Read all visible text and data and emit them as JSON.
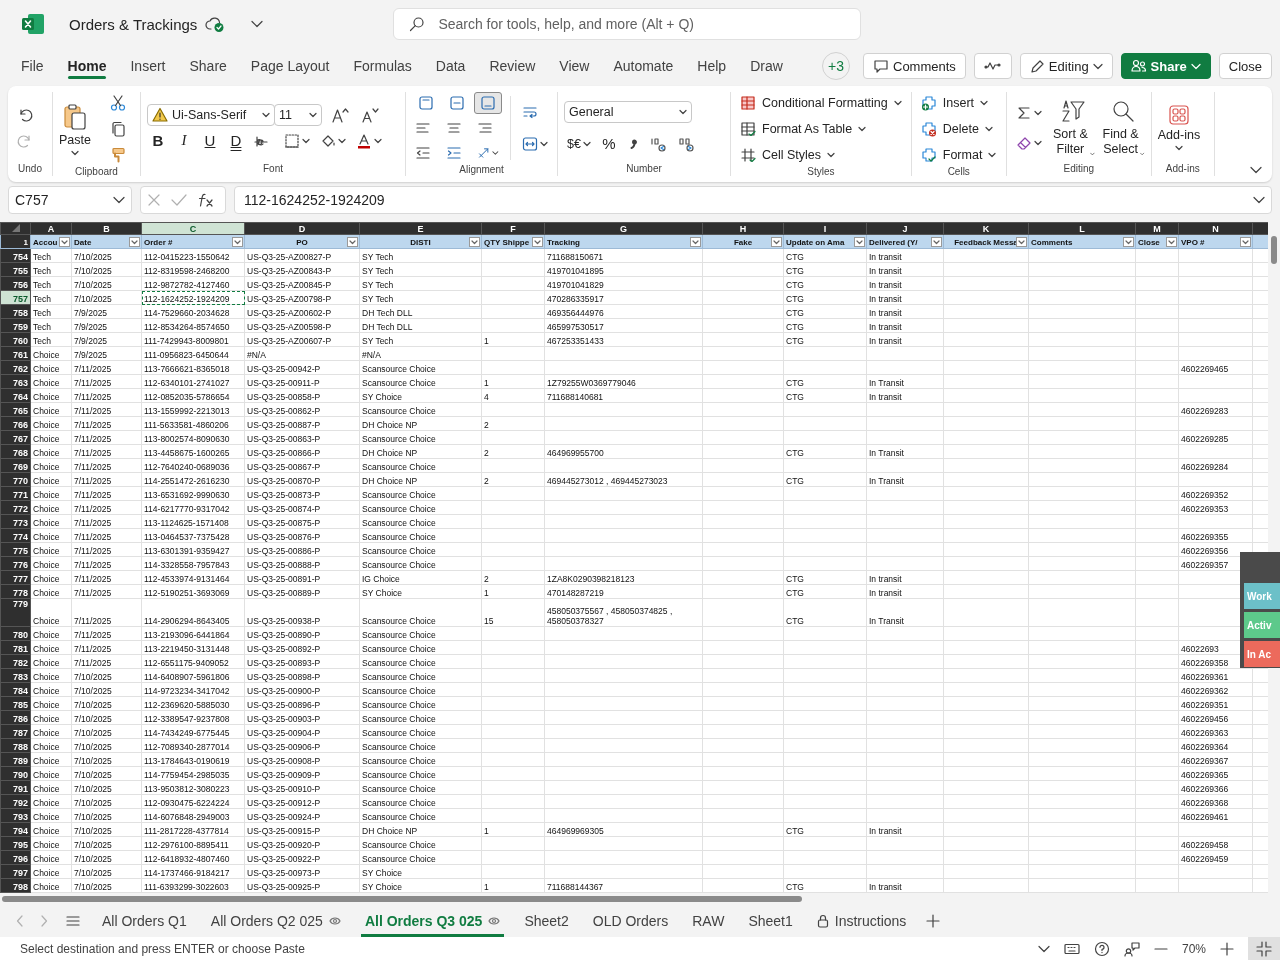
{
  "window": {
    "title": "Orders & Trackings"
  },
  "search": {
    "placeholder": "Search for tools, help, and more (Alt + Q)"
  },
  "tabs": [
    {
      "label": "File",
      "selected": false
    },
    {
      "label": "Home",
      "selected": true
    },
    {
      "label": "Insert",
      "selected": false
    },
    {
      "label": "Share",
      "selected": false
    },
    {
      "label": "Page Layout",
      "selected": false
    },
    {
      "label": "Formulas",
      "selected": false
    },
    {
      "label": "Data",
      "selected": false
    },
    {
      "label": "Review",
      "selected": false
    },
    {
      "label": "View",
      "selected": false
    },
    {
      "label": "Automate",
      "selected": false
    },
    {
      "label": "Help",
      "selected": false
    },
    {
      "label": "Draw",
      "selected": false
    }
  ],
  "header_buttons": [
    {
      "kind": "presence",
      "label": "+3"
    },
    {
      "kind": "comments",
      "label": "Comments"
    },
    {
      "kind": "activity"
    },
    {
      "kind": "editing",
      "label": "Editing"
    },
    {
      "kind": "share",
      "label": "Share"
    },
    {
      "kind": "close",
      "label": "Close"
    }
  ],
  "ribbon": {
    "groups": [
      {
        "kind": "undo",
        "label": "Undo"
      },
      {
        "kind": "clipboard",
        "label": "Clipboard",
        "items": [
          "Paste"
        ]
      },
      {
        "kind": "font",
        "label": "Font",
        "font": "Ui-Sans-Serif",
        "size": "11",
        "items": [
          "B",
          "I",
          "U",
          "D"
        ]
      },
      {
        "kind": "alignment",
        "label": "Alignment",
        "vertical_align": [
          {
            "selected": false
          },
          {
            "selected": false
          },
          {
            "selected": true
          }
        ]
      },
      {
        "kind": "number",
        "label": "Number",
        "format": "General",
        "items": [
          "$€",
          "%"
        ]
      },
      {
        "kind": "styles",
        "label": "Styles",
        "items": [
          "Conditional Formatting",
          "Format As Table",
          "Cell Styles"
        ]
      },
      {
        "kind": "cells",
        "label": "Cells",
        "items": [
          "Insert",
          "Delete",
          "Format"
        ]
      },
      {
        "kind": "editing",
        "label": "Editing",
        "items": [
          "Sort & Filter",
          "Find & Select"
        ]
      },
      {
        "kind": "addins",
        "label": "Add-ins",
        "items": [
          "Add-ins"
        ]
      }
    ]
  },
  "formula_bar": {
    "name_box": "C757",
    "formula": "112-1624252-1924209"
  },
  "grid": {
    "header_row": "1",
    "columns": [
      {
        "letter": "A",
        "header": "Accou",
        "selected": false
      },
      {
        "letter": "B",
        "header": "Date",
        "selected": false
      },
      {
        "letter": "C",
        "header": "Order #",
        "selected": true
      },
      {
        "letter": "D",
        "header": "PO",
        "selected": false
      },
      {
        "letter": "E",
        "header": "DISTI",
        "selected": false
      },
      {
        "letter": "F",
        "header": "QTY Shippe",
        "selected": false
      },
      {
        "letter": "G",
        "header": "Tracking",
        "selected": false
      },
      {
        "letter": "H",
        "header": "Fake",
        "selected": false
      },
      {
        "letter": "I",
        "header": "Update on Ama",
        "selected": false
      },
      {
        "letter": "J",
        "header": "Delivered (Y/",
        "selected": false
      },
      {
        "letter": "K",
        "header": "Feedback Messa",
        "selected": false
      },
      {
        "letter": "L",
        "header": "Comments",
        "selected": false
      },
      {
        "letter": "M",
        "header": "Close",
        "selected": false
      },
      {
        "letter": "N",
        "header": "VPO #",
        "selected": false
      }
    ],
    "rows": [
      {
        "row": "754",
        "selected": false,
        "A": "Tech",
        "B": "7/10/2025",
        "C": "112-0415223-1550642",
        "D": "US-Q3-25-AZ00827-P",
        "E": "SY Tech",
        "G": "711688150671",
        "I": "CTG",
        "J": "In transit"
      },
      {
        "row": "755",
        "selected": false,
        "A": "Tech",
        "B": "7/10/2025",
        "C": "112-8319598-2468200",
        "D": "US-Q3-25-AZ00843-P",
        "E": "SY Tech",
        "G": "419701041895",
        "I": "CTG",
        "J": "In transit"
      },
      {
        "row": "756",
        "selected": false,
        "A": "Tech",
        "B": "7/10/2025",
        "C": "112-9872782-4127460",
        "D": "US-Q3-25-AZ00845-P",
        "E": "SY Tech",
        "G": "419701041829",
        "I": "CTG",
        "J": "In transit"
      },
      {
        "row": "757",
        "selected": true,
        "A": "Tech",
        "B": "7/10/2025",
        "C": "112-1624252-1924209",
        "D": "US-Q3-25-AZ00798-P",
        "E": "SY Tech",
        "G": "470286335917",
        "I": "CTG",
        "J": "In transit"
      },
      {
        "row": "758",
        "selected": false,
        "A": "Tech",
        "B": "7/9/2025",
        "C": "114-7529660-2034628",
        "D": "US-Q3-25-AZ00602-P",
        "E": "DH Tech DLL",
        "G": "469356444976",
        "I": "CTG",
        "J": "In transit"
      },
      {
        "row": "759",
        "selected": false,
        "A": "Tech",
        "B": "7/9/2025",
        "C": "112-8534264-8574650",
        "D": "US-Q3-25-AZ00598-P",
        "E": "DH Tech DLL",
        "G": "465997530517",
        "I": "CTG",
        "J": "In transit"
      },
      {
        "row": "760",
        "selected": false,
        "A": "Tech",
        "B": "7/9/2025",
        "C": "111-7429943-8009801",
        "D": "US-Q3-25-AZ00607-P",
        "E": "SY Tech",
        "F": "1",
        "G": "467253351433",
        "I": "CTG",
        "J": "In transit"
      },
      {
        "row": "761",
        "selected": false,
        "A": "Choice",
        "B": "7/9/2025",
        "C": "111-0956823-6450644",
        "D": "#N/A",
        "E": "#N/A"
      },
      {
        "row": "762",
        "selected": false,
        "A": "Choice",
        "B": "7/11/2025",
        "C": "113-7666621-8365018",
        "D": "US-Q3-25-00942-P",
        "E": "Scansource Choice",
        "N": "4602269465"
      },
      {
        "row": "763",
        "selected": false,
        "A": "Choice",
        "B": "7/11/2025",
        "C": "112-6340101-2741027",
        "D": "US-Q3-25-00911-P",
        "E": "Scansource Choice",
        "F": "1",
        "G": "1Z79255W0369779046",
        "I": "CTG",
        "J": "In Transit"
      },
      {
        "row": "764",
        "selected": false,
        "A": "Choice",
        "B": "7/11/2025",
        "C": "112-0852035-5786654",
        "D": "US-Q3-25-00858-P",
        "E": "SY Choice",
        "F": "4",
        "G": "711688140681",
        "I": "CTG",
        "J": "In transit"
      },
      {
        "row": "765",
        "selected": false,
        "A": "Choice",
        "B": "7/11/2025",
        "C": "113-1559992-2213013",
        "D": "US-Q3-25-00862-P",
        "E": "Scansource Choice",
        "N": "4602269283"
      },
      {
        "row": "766",
        "selected": false,
        "A": "Choice",
        "B": "7/11/2025",
        "C": "111-5633581-4860206",
        "D": "US-Q3-25-00887-P",
        "E": "DH Choice NP",
        "F": "2"
      },
      {
        "row": "767",
        "selected": false,
        "A": "Choice",
        "B": "7/11/2025",
        "C": "113-8002574-8090630",
        "D": "US-Q3-25-00863-P",
        "E": "Scansource Choice",
        "N": "4602269285"
      },
      {
        "row": "768",
        "selected": false,
        "A": "Choice",
        "B": "7/11/2025",
        "C": "113-4458675-1600265",
        "D": "US-Q3-25-00866-P",
        "E": "DH Choice NP",
        "F": "2",
        "G": "464969955700",
        "I": "CTG",
        "J": "In Transit"
      },
      {
        "row": "769",
        "selected": false,
        "A": "Choice",
        "B": "7/11/2025",
        "C": "112-7640240-0689036",
        "D": "US-Q3-25-00867-P",
        "E": "Scansource Choice",
        "N": "4602269284"
      },
      {
        "row": "770",
        "selected": false,
        "A": "Choice",
        "B": "7/11/2025",
        "C": "114-2551472-2616230",
        "D": "US-Q3-25-00870-P",
        "E": "DH Choice NP",
        "F": "2",
        "G": "469445273012 , 469445273023",
        "I": "CTG",
        "J": "In Transit"
      },
      {
        "row": "771",
        "selected": false,
        "A": "Choice",
        "B": "7/11/2025",
        "C": "113-6531692-9990630",
        "D": "US-Q3-25-00873-P",
        "E": "Scansource Choice",
        "N": "4602269352"
      },
      {
        "row": "772",
        "selected": false,
        "A": "Choice",
        "B": "7/11/2025",
        "C": "114-6217770-9317042",
        "D": "US-Q3-25-00874-P",
        "E": "Scansource Choice",
        "N": "4602269353"
      },
      {
        "row": "773",
        "selected": false,
        "A": "Choice",
        "B": "7/11/2025",
        "C": "113-1124625-1571408",
        "D": "US-Q3-25-00875-P",
        "E": "Scansource Choice"
      },
      {
        "row": "774",
        "selected": false,
        "A": "Choice",
        "B": "7/11/2025",
        "C": "113-0464537-7375428",
        "D": "US-Q3-25-00876-P",
        "E": "Scansource Choice",
        "N": "4602269355"
      },
      {
        "row": "775",
        "selected": false,
        "A": "Choice",
        "B": "7/11/2025",
        "C": "113-6301391-9359427",
        "D": "US-Q3-25-00886-P",
        "E": "Scansource Choice",
        "N": "4602269356"
      },
      {
        "row": "776",
        "selected": false,
        "A": "Choice",
        "B": "7/11/2025",
        "C": "114-3328558-7957843",
        "D": "US-Q3-25-00888-P",
        "E": "Scansource Choice",
        "N": "4602269357"
      },
      {
        "row": "777",
        "selected": false,
        "A": "Choice",
        "B": "7/11/2025",
        "C": "112-4533974-9131464",
        "D": "US-Q3-25-00891-P",
        "E": "IG Choice",
        "F": "2",
        "G": "1ZA8K0290398218123",
        "I": "CTG",
        "J": "In transit"
      },
      {
        "row": "778",
        "selected": false,
        "A": "Choice",
        "B": "7/11/2025",
        "C": "112-5190251-3693069",
        "D": "US-Q3-25-00889-P",
        "E": "SY Choice",
        "F": "1",
        "G": "470148287219",
        "I": "CTG",
        "J": "In transit"
      },
      {
        "row": "779",
        "selected": false,
        "A": "Choice",
        "B": "7/11/2025",
        "C": "114-2906294-8643405",
        "D": "US-Q3-25-00938-P",
        "E": "Scansource Choice",
        "F": "15",
        "G": "458050375567 , 458050374825 , 458050378327",
        "I": "CTG",
        "J": "In Transit"
      },
      {
        "row": "780",
        "selected": false,
        "A": "Choice",
        "B": "7/11/2025",
        "C": "113-2193096-6441864",
        "D": "US-Q3-25-00890-P",
        "E": "Scansource Choice"
      },
      {
        "row": "781",
        "selected": false,
        "A": "Choice",
        "B": "7/11/2025",
        "C": "113-2219450-3131448",
        "D": "US-Q3-25-00892-P",
        "E": "Scansource Choice",
        "N": "46022693"
      },
      {
        "row": "782",
        "selected": false,
        "A": "Choice",
        "B": "7/11/2025",
        "C": "112-6551175-9409052",
        "D": "US-Q3-25-00893-P",
        "E": "Scansource Choice",
        "N": "4602269358"
      },
      {
        "row": "783",
        "selected": false,
        "A": "Choice",
        "B": "7/10/2025",
        "C": "114-6408907-5961806",
        "D": "US-Q3-25-00898-P",
        "E": "Scansource Choice",
        "N": "4602269361"
      },
      {
        "row": "784",
        "selected": false,
        "A": "Choice",
        "B": "7/10/2025",
        "C": "114-9723234-3417042",
        "D": "US-Q3-25-00900-P",
        "E": "Scansource Choice",
        "N": "4602269362"
      },
      {
        "row": "785",
        "selected": false,
        "A": "Choice",
        "B": "7/10/2025",
        "C": "112-2369620-5885030",
        "D": "US-Q3-25-00896-P",
        "E": "Scansource Choice",
        "N": "4602269351"
      },
      {
        "row": "786",
        "selected": false,
        "A": "Choice",
        "B": "7/10/2025",
        "C": "112-3389547-9237808",
        "D": "US-Q3-25-00903-P",
        "E": "Scansource Choice",
        "N": "4602269456"
      },
      {
        "row": "787",
        "selected": false,
        "A": "Choice",
        "B": "7/10/2025",
        "C": "114-7434249-6775445",
        "D": "US-Q3-25-00904-P",
        "E": "Scansource Choice",
        "N": "4602269363"
      },
      {
        "row": "788",
        "selected": false,
        "A": "Choice",
        "B": "7/10/2025",
        "C": "112-7089340-2877014",
        "D": "US-Q3-25-00906-P",
        "E": "Scansource Choice",
        "N": "4602269364"
      },
      {
        "row": "789",
        "selected": false,
        "A": "Choice",
        "B": "7/10/2025",
        "C": "113-1784643-0190619",
        "D": "US-Q3-25-00908-P",
        "E": "Scansource Choice",
        "N": "4602269367"
      },
      {
        "row": "790",
        "selected": false,
        "A": "Choice",
        "B": "7/10/2025",
        "C": "114-7759454-2985035",
        "D": "US-Q3-25-00909-P",
        "E": "Scansource Choice",
        "N": "4602269365"
      },
      {
        "row": "791",
        "selected": false,
        "A": "Choice",
        "B": "7/10/2025",
        "C": "113-9503812-3080223",
        "D": "US-Q3-25-00910-P",
        "E": "Scansource Choice",
        "N": "4602269366"
      },
      {
        "row": "792",
        "selected": false,
        "A": "Choice",
        "B": "7/10/2025",
        "C": "112-0930475-6224224",
        "D": "US-Q3-25-00912-P",
        "E": "Scansource Choice",
        "N": "4602269368"
      },
      {
        "row": "793",
        "selected": false,
        "A": "Choice",
        "B": "7/10/2025",
        "C": "114-6076848-2949003",
        "D": "US-Q3-25-00924-P",
        "E": "Scansource Choice",
        "N": "4602269461"
      },
      {
        "row": "794",
        "selected": false,
        "A": "Choice",
        "B": "7/10/2025",
        "C": "111-2817228-4377814",
        "D": "US-Q3-25-00915-P",
        "E": "DH Choice NP",
        "F": "1",
        "G": "464969969305",
        "I": "CTG",
        "J": "In transit"
      },
      {
        "row": "795",
        "selected": false,
        "A": "Choice",
        "B": "7/10/2025",
        "C": "112-2976100-8895411",
        "D": "US-Q3-25-00920-P",
        "E": "Scansource Choice",
        "N": "4602269458"
      },
      {
        "row": "796",
        "selected": false,
        "A": "Choice",
        "B": "7/10/2025",
        "C": "112-6418932-4807460",
        "D": "US-Q3-25-00922-P",
        "E": "Scansource Choice",
        "N": "4602269459"
      },
      {
        "row": "797",
        "selected": false,
        "A": "Choice",
        "B": "7/10/2025",
        "C": "114-1737466-9184217",
        "D": "US-Q3-25-00973-P",
        "E": "SY Choice"
      },
      {
        "row": "798",
        "selected": false,
        "A": "Choice",
        "B": "7/10/2025",
        "C": "111-6393299-3022603",
        "D": "US-Q3-25-00925-P",
        "E": "SY Choice",
        "F": "1",
        "G": "711688144367",
        "I": "CTG",
        "J": "In transit"
      }
    ]
  },
  "overlay": {
    "buttons": [
      {
        "label": "Work",
        "color": "#6cc0c8"
      },
      {
        "label": "Activ",
        "color": "#5dc98b"
      },
      {
        "label": "In Ac",
        "color": "#ec6a5c"
      }
    ]
  },
  "sheet_tabs": [
    {
      "label": "All Orders Q1",
      "kind": "plain",
      "selected": false
    },
    {
      "label": "All Orders Q2 025",
      "kind": "view",
      "selected": false
    },
    {
      "label": "All Orders Q3 025",
      "kind": "view",
      "selected": true
    },
    {
      "label": "Sheet2",
      "kind": "plain",
      "selected": false
    },
    {
      "label": "OLD Orders",
      "kind": "plain",
      "selected": false
    },
    {
      "label": "RAW",
      "kind": "plain",
      "selected": false
    },
    {
      "label": "Sheet1",
      "kind": "plain",
      "selected": false
    },
    {
      "label": "Instructions",
      "kind": "locked",
      "selected": false
    }
  ],
  "status_bar": {
    "message": "Select destination and press ENTER or choose Paste",
    "zoom": "70%"
  }
}
